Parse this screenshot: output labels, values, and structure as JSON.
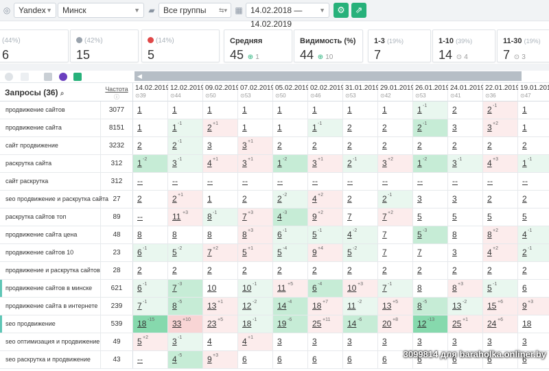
{
  "toolbar": {
    "engine": "Yandex",
    "region": "Минск",
    "group": "Все группы",
    "date_range": "14.02.2018 — 14.02.2019"
  },
  "summary": {
    "c1": {
      "label": "(44%)",
      "value": "6"
    },
    "c2": {
      "label": "(42%)",
      "value": "15"
    },
    "c3": {
      "label": "(14%)",
      "value": "5"
    },
    "avg": {
      "label": "Средняя",
      "value": "45",
      "change": "1"
    },
    "vis": {
      "label": "Видимость (%)",
      "value": "44",
      "change": "10"
    },
    "top3": {
      "label": "1-3",
      "pct": "(19%)",
      "value": "7"
    },
    "top10": {
      "label": "1-10",
      "pct": "(39%)",
      "value": "14",
      "change": "4"
    },
    "top30": {
      "label": "11-30",
      "pct": "(19%)",
      "value": "7",
      "change": "3"
    }
  },
  "table": {
    "title": "Запросы (36)",
    "freq_label": "Частота",
    "dates": [
      {
        "d": "14.02.2019",
        "c": "39"
      },
      {
        "d": "12.02.2019",
        "c": "44"
      },
      {
        "d": "09.02.2019",
        "c": "50"
      },
      {
        "d": "07.02.2019",
        "c": "53"
      },
      {
        "d": "05.02.2019",
        "c": "50"
      },
      {
        "d": "02.02.2019",
        "c": "46"
      },
      {
        "d": "31.01.2019",
        "c": "53"
      },
      {
        "d": "29.01.2019",
        "c": "42"
      },
      {
        "d": "26.01.2019",
        "c": "53"
      },
      {
        "d": "24.01.2019",
        "c": "41"
      },
      {
        "d": "22.01.2019",
        "c": "36"
      },
      {
        "d": "19.01.2019",
        "c": "47"
      }
    ],
    "rows": [
      {
        "q": "продвижение сайтов",
        "f": "3077",
        "mark": false,
        "cells": [
          [
            "1",
            "",
            ""
          ],
          [
            "1",
            "",
            ""
          ],
          [
            "1",
            "",
            ""
          ],
          [
            "1",
            "",
            ""
          ],
          [
            "1",
            "",
            ""
          ],
          [
            "1",
            "",
            ""
          ],
          [
            "1",
            "",
            ""
          ],
          [
            "1",
            "",
            ""
          ],
          [
            "1",
            "-1",
            "g1"
          ],
          [
            "2",
            "",
            ""
          ],
          [
            "2",
            "-1",
            "r1"
          ],
          [
            "1",
            "",
            ""
          ]
        ]
      },
      {
        "q": "продвижение сайта",
        "f": "8151",
        "mark": false,
        "cells": [
          [
            "1",
            "",
            ""
          ],
          [
            "1",
            "-1",
            "g1"
          ],
          [
            "2",
            "+1",
            "r1"
          ],
          [
            "1",
            "",
            ""
          ],
          [
            "1",
            "",
            ""
          ],
          [
            "1",
            "-1",
            "g1"
          ],
          [
            "2",
            "",
            ""
          ],
          [
            "2",
            "",
            ""
          ],
          [
            "2",
            "-1",
            "g2"
          ],
          [
            "3",
            "",
            ""
          ],
          [
            "3",
            "+2",
            "r1"
          ],
          [
            "1",
            "",
            ""
          ]
        ]
      },
      {
        "q": "сайт продвижение",
        "f": "3232",
        "mark": false,
        "cells": [
          [
            "2",
            "",
            ""
          ],
          [
            "2",
            "-1",
            "g1"
          ],
          [
            "3",
            "",
            ""
          ],
          [
            "3",
            "+1",
            "r1"
          ],
          [
            "2",
            "",
            ""
          ],
          [
            "2",
            "",
            ""
          ],
          [
            "2",
            "",
            ""
          ],
          [
            "2",
            "",
            ""
          ],
          [
            "2",
            "",
            ""
          ],
          [
            "2",
            "",
            ""
          ],
          [
            "2",
            "",
            ""
          ],
          [
            "2",
            "",
            ""
          ]
        ]
      },
      {
        "q": "раскрутка сайта",
        "f": "312",
        "mark": false,
        "cells": [
          [
            "1",
            "-2",
            "g2"
          ],
          [
            "3",
            "-1",
            "g1"
          ],
          [
            "4",
            "+1",
            "r1"
          ],
          [
            "3",
            "+1",
            "r1"
          ],
          [
            "1",
            "-2",
            "g2"
          ],
          [
            "3",
            "+1",
            "r1"
          ],
          [
            "2",
            "-1",
            "g1"
          ],
          [
            "3",
            "+2",
            "r1"
          ],
          [
            "1",
            "-2",
            "g2"
          ],
          [
            "3",
            "-1",
            "g1"
          ],
          [
            "4",
            "+3",
            "r1"
          ],
          [
            "1",
            "-1",
            "g1"
          ]
        ]
      },
      {
        "q": "сайт раскрутка",
        "f": "312",
        "mark": false,
        "cells": [
          [
            "--",
            "",
            ""
          ],
          [
            "--",
            "",
            ""
          ],
          [
            "--",
            "",
            ""
          ],
          [
            "--",
            "",
            ""
          ],
          [
            "--",
            "",
            ""
          ],
          [
            "--",
            "",
            ""
          ],
          [
            "--",
            "",
            ""
          ],
          [
            "--",
            "",
            ""
          ],
          [
            "--",
            "",
            ""
          ],
          [
            "--",
            "",
            ""
          ],
          [
            "--",
            "",
            ""
          ],
          [
            "--",
            "",
            ""
          ]
        ]
      },
      {
        "q": "seo продвижение и раскрутка сайта",
        "f": "27",
        "mark": false,
        "cells": [
          [
            "2",
            "",
            ""
          ],
          [
            "2",
            "+1",
            "r1"
          ],
          [
            "1",
            "",
            ""
          ],
          [
            "2",
            "",
            ""
          ],
          [
            "2",
            "-2",
            "g1"
          ],
          [
            "4",
            "+2",
            "r1"
          ],
          [
            "2",
            "",
            ""
          ],
          [
            "2",
            "-1",
            "g1"
          ],
          [
            "3",
            "",
            ""
          ],
          [
            "3",
            "",
            ""
          ],
          [
            "2",
            "",
            ""
          ],
          [
            "2",
            "",
            ""
          ]
        ]
      },
      {
        "q": "раскрутка сайтов топ",
        "f": "89",
        "mark": false,
        "cells": [
          [
            "--",
            "",
            ""
          ],
          [
            "11",
            "+3",
            "r1"
          ],
          [
            "8",
            "-1",
            "g1"
          ],
          [
            "7",
            "+3",
            "r1"
          ],
          [
            "4",
            "-3",
            "g2"
          ],
          [
            "9",
            "+2",
            "r1"
          ],
          [
            "7",
            "",
            ""
          ],
          [
            "7",
            "+2",
            "r1"
          ],
          [
            "5",
            "",
            ""
          ],
          [
            "5",
            "",
            ""
          ],
          [
            "5",
            "",
            ""
          ],
          [
            "5",
            "",
            ""
          ]
        ]
      },
      {
        "q": "продвижение сайта цена",
        "f": "48",
        "mark": false,
        "cells": [
          [
            "8",
            "",
            ""
          ],
          [
            "8",
            "",
            ""
          ],
          [
            "8",
            "",
            ""
          ],
          [
            "8",
            "+3",
            "r1"
          ],
          [
            "6",
            "-1",
            "g1"
          ],
          [
            "5",
            "-1",
            "g1"
          ],
          [
            "4",
            "-2",
            "g1"
          ],
          [
            "7",
            "",
            ""
          ],
          [
            "5",
            "-3",
            "g2"
          ],
          [
            "8",
            "",
            ""
          ],
          [
            "8",
            "+2",
            "r1"
          ],
          [
            "4",
            "-1",
            "g1"
          ]
        ]
      },
      {
        "q": "продвижение сайтов 10",
        "f": "23",
        "mark": false,
        "cells": [
          [
            "6",
            "-1",
            "g1"
          ],
          [
            "5",
            "-2",
            "g1"
          ],
          [
            "7",
            "+2",
            "r1"
          ],
          [
            "5",
            "+1",
            "r1"
          ],
          [
            "5",
            "-4",
            "g1"
          ],
          [
            "9",
            "+4",
            "r1"
          ],
          [
            "5",
            "-2",
            "g1"
          ],
          [
            "7",
            "",
            ""
          ],
          [
            "7",
            "",
            ""
          ],
          [
            "3",
            "",
            ""
          ],
          [
            "4",
            "+2",
            "r1"
          ],
          [
            "2",
            "-1",
            "g1"
          ]
        ]
      },
      {
        "q": "продвижение и раскрутка сайтов",
        "f": "28",
        "mark": false,
        "cells": [
          [
            "2",
            "",
            ""
          ],
          [
            "2",
            "",
            ""
          ],
          [
            "2",
            "",
            ""
          ],
          [
            "2",
            "",
            ""
          ],
          [
            "2",
            "",
            ""
          ],
          [
            "2",
            "",
            ""
          ],
          [
            "2",
            "",
            ""
          ],
          [
            "2",
            "",
            ""
          ],
          [
            "2",
            "",
            ""
          ],
          [
            "2",
            "",
            ""
          ],
          [
            "2",
            "",
            ""
          ],
          [
            "2",
            "",
            ""
          ]
        ]
      },
      {
        "q": "продвижение сайтов в минске",
        "f": "621",
        "mark": true,
        "cells": [
          [
            "6",
            "-1",
            "g1"
          ],
          [
            "7",
            "-3",
            "g2"
          ],
          [
            "10",
            "",
            ""
          ],
          [
            "10",
            "-1",
            "g1"
          ],
          [
            "11",
            "+5",
            "r1"
          ],
          [
            "6",
            "-4",
            "g2"
          ],
          [
            "10",
            "+3",
            "r1"
          ],
          [
            "7",
            "-1",
            "g1"
          ],
          [
            "8",
            "",
            ""
          ],
          [
            "8",
            "+3",
            "r1"
          ],
          [
            "5",
            "-1",
            "g1"
          ],
          [
            "6",
            "",
            ""
          ]
        ]
      },
      {
        "q": "продвижение сайта в интернете",
        "f": "239",
        "mark": false,
        "cells": [
          [
            "7",
            "-1",
            "g1"
          ],
          [
            "8",
            "-5",
            "g2"
          ],
          [
            "13",
            "+1",
            "r1"
          ],
          [
            "12",
            "-2",
            "g1"
          ],
          [
            "14",
            "-4",
            "g2"
          ],
          [
            "18",
            "+7",
            "r1"
          ],
          [
            "11",
            "-2",
            "g1"
          ],
          [
            "13",
            "+5",
            "r1"
          ],
          [
            "8",
            "-5",
            "g2"
          ],
          [
            "13",
            "-2",
            "g1"
          ],
          [
            "15",
            "+6",
            "r1"
          ],
          [
            "9",
            "+3",
            "r1"
          ]
        ]
      },
      {
        "q": "seo продвижение",
        "f": "539",
        "mark": true,
        "cells": [
          [
            "18",
            "-15",
            "g3"
          ],
          [
            "33",
            "+10",
            "r2"
          ],
          [
            "23",
            "+5",
            "r1"
          ],
          [
            "18",
            "-1",
            "g1"
          ],
          [
            "19",
            "-6",
            "g2"
          ],
          [
            "25",
            "+11",
            "r1"
          ],
          [
            "14",
            "-6",
            "g2"
          ],
          [
            "20",
            "+8",
            "r1"
          ],
          [
            "12",
            "-13",
            "g3"
          ],
          [
            "25",
            "+1",
            "r1"
          ],
          [
            "24",
            "+6",
            "r1"
          ],
          [
            "18",
            "",
            ""
          ]
        ]
      },
      {
        "q": "seo оптимизация и продвижение",
        "f": "49",
        "mark": false,
        "cells": [
          [
            "5",
            "+2",
            "r1"
          ],
          [
            "3",
            "-1",
            "g1"
          ],
          [
            "4",
            "",
            ""
          ],
          [
            "4",
            "+1",
            "r1"
          ],
          [
            "3",
            "",
            ""
          ],
          [
            "3",
            "",
            ""
          ],
          [
            "3",
            "",
            ""
          ],
          [
            "3",
            "",
            ""
          ],
          [
            "3",
            "",
            ""
          ],
          [
            "3",
            "",
            ""
          ],
          [
            "3",
            "",
            ""
          ],
          [
            "3",
            "",
            ""
          ]
        ]
      },
      {
        "q": "seo раскрутка и продвижение",
        "f": "43",
        "mark": false,
        "cells": [
          [
            "--",
            "",
            ""
          ],
          [
            "4",
            "-5",
            "g2"
          ],
          [
            "9",
            "+3",
            "r1"
          ],
          [
            "6",
            "",
            ""
          ],
          [
            "6",
            "",
            ""
          ],
          [
            "6",
            "",
            ""
          ],
          [
            "6",
            "",
            ""
          ],
          [
            "6",
            "",
            ""
          ],
          [
            "6",
            "",
            ""
          ],
          [
            "6",
            "",
            ""
          ],
          [
            "6",
            "",
            ""
          ],
          [
            "6",
            "",
            ""
          ]
        ]
      }
    ]
  },
  "watermark": "3099814 для baraholka.onliner.by",
  "colors": {
    "accent": "#27b17a",
    "green_light": "#e9f7ef",
    "green_mid": "#c6ecd6",
    "green_strong": "#86d9ad",
    "red_light": "#fcecec",
    "red_mid": "#f8d5d5"
  }
}
